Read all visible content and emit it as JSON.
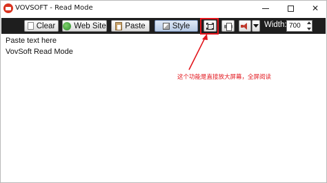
{
  "window": {
    "title": "VOVSOFT - Read Mode",
    "controls": {
      "minimize_icon": "minimize-icon",
      "maximize_icon": "maximize-icon",
      "close_glyph": "✕"
    }
  },
  "toolbar": {
    "clear_label": "Clear",
    "website_label": "Web Site",
    "paste_label": "Paste",
    "style_label": "Style",
    "fullscreen_icon": "fullscreen-icon",
    "print_icon": "printer-icon",
    "speak_icon": "speaker-icon",
    "width_label": "Width:",
    "width_value": "700"
  },
  "content": {
    "lines": [
      "Paste text here",
      "VovSoft Read Mode"
    ]
  },
  "annotation": {
    "text": "这个功能是直接放大屏幕，全屏阅读"
  },
  "colors": {
    "toolbar_bg": "#1e1e1e",
    "highlight": "#e2151c",
    "app_icon": "#d9331f"
  }
}
